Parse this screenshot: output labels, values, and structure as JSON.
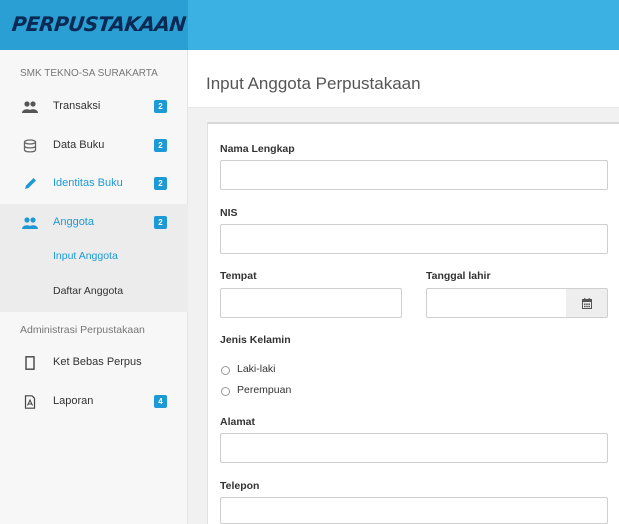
{
  "app": {
    "brand": "PERPUSTAKAAN",
    "school": "SMK TEKNO-SA SURAKARTA"
  },
  "sidebar": {
    "items": [
      {
        "label": "Transaksi",
        "badge": "2",
        "icon": "users-icon"
      },
      {
        "label": "Data Buku",
        "badge": "2",
        "icon": "database-icon"
      },
      {
        "label": "Identitas Buku",
        "badge": "2",
        "icon": "pencil-icon"
      },
      {
        "label": "Anggota",
        "badge": "2",
        "icon": "users-icon"
      }
    ],
    "submenu": [
      {
        "label": "Input Anggota"
      },
      {
        "label": "Daftar Anggota"
      }
    ],
    "section_title": "Administrasi Perpustakaan",
    "admin_items": [
      {
        "label": "Ket Bebas Perpus",
        "icon": "document-icon"
      },
      {
        "label": "Laporan",
        "badge": "4",
        "icon": "pdf-icon"
      }
    ]
  },
  "main": {
    "title": "Input Anggota Perpustakaan",
    "form": {
      "nama_label": "Nama Lengkap",
      "nama_value": "",
      "nis_label": "NIS",
      "nis_value": "",
      "tempat_label": "Tempat",
      "tempat_value": "",
      "tanggal_label": "Tanggal lahir",
      "tanggal_value": "",
      "gender_label": "Jenis Kelamin",
      "gender_options": [
        "Laki-laki",
        "Perempuan"
      ],
      "alamat_label": "Alamat",
      "alamat_value": "",
      "telepon_label": "Telepon",
      "telepon_value": ""
    }
  },
  "colors": {
    "topbar": "#3ab1e2",
    "brand_bg": "#2a9fd3",
    "accent": "#1d9ad6",
    "brand_text": "#0a2a55"
  }
}
